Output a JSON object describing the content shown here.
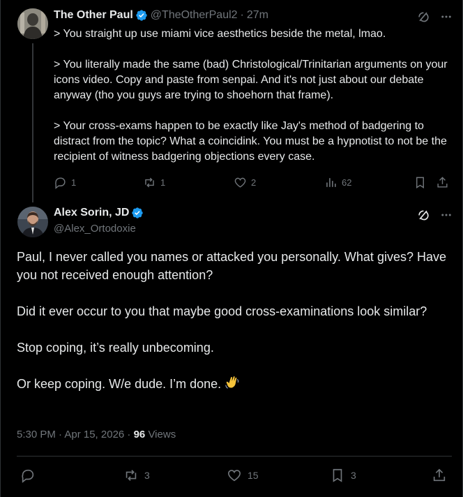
{
  "tweet1": {
    "author_name": "The Other Paul",
    "handle": "@TheOtherPaul2",
    "time": "27m",
    "paragraphs": [
      "> You straight up use miami vice aesthetics beside the metal, lmao.",
      "> You literally made the same (bad) Christological/Trinitarian arguments on your icons video. Copy and paste from senpai. And it's not just about our debate anyway (tho you guys are trying to shoehorn that frame).",
      "> Your cross-exams happen to be exactly like Jay's method of badgering to distract from the topic? What a coincidink.  You must be a hypnotist to not be the recipient of witness badgering objections every case."
    ],
    "replies": "1",
    "reposts": "1",
    "likes": "2",
    "views": "62"
  },
  "tweet2": {
    "author_name": "Alex Sorin, JD",
    "handle": "@Alex_Ortodoxie",
    "paragraphs": [
      "Paul, I never called you names or attacked you personally.  What gives? Have you not received enough attention?",
      "Did it ever occur to you that maybe good cross-examinations look similar?",
      "Stop coping, it’s really unbecoming.",
      "Or keep coping.  W/e dude.  I’m done."
    ],
    "timestamp": "5:30 PM · Apr 15, 2026 · ",
    "views_count": "96",
    "views_label": " Views",
    "replies": "",
    "reposts": "3",
    "likes": "15",
    "bookmarks": "3"
  },
  "colors": {
    "background": "#000000",
    "text": "#e7e9ea",
    "muted": "#71767b",
    "verified": "#1d9bf0",
    "divider": "#2f3336"
  },
  "icons": [
    "verified-badge-icon",
    "grok-icon",
    "more-icon",
    "reply-icon",
    "repost-icon",
    "like-icon",
    "views-icon",
    "bookmark-icon",
    "share-icon",
    "wave-emoji"
  ]
}
